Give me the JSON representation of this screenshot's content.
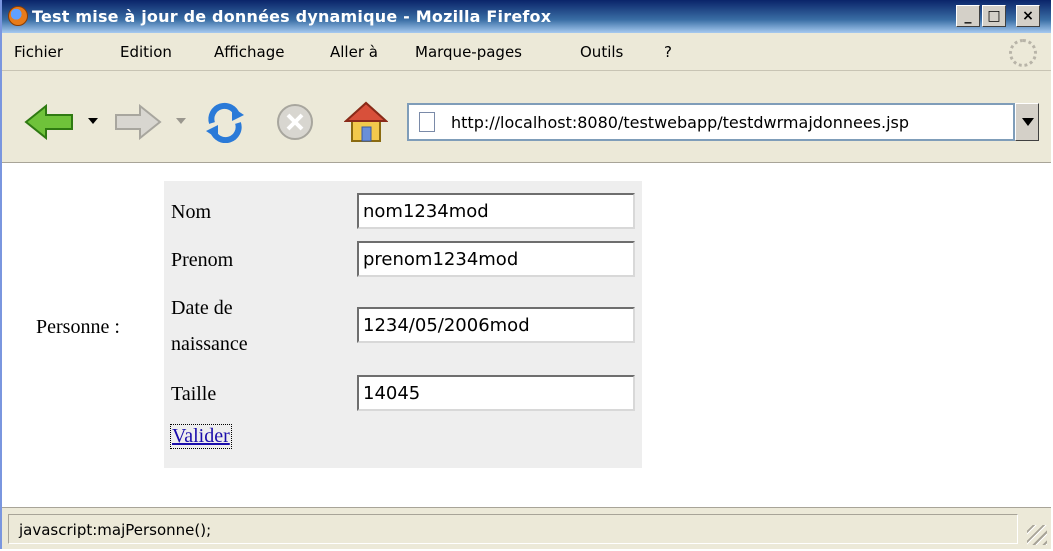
{
  "window": {
    "title": "Test mise à jour de données dynamique - Mozilla Firefox",
    "min_label": "_",
    "max_label": "□",
    "close_label": "×"
  },
  "menu": {
    "items": [
      {
        "label": "Fichier"
      },
      {
        "label": "Edition"
      },
      {
        "label": "Affichage"
      },
      {
        "label": "Aller à"
      },
      {
        "label": "Marque-pages"
      },
      {
        "label": "Outils"
      },
      {
        "label": "?"
      }
    ]
  },
  "navbar": {
    "url": "http://localhost:8080/testwebapp/testdwrmajdonnees.jsp"
  },
  "form": {
    "section_label": "Personne :",
    "fields": [
      {
        "label": "Nom",
        "value": "nom1234mod"
      },
      {
        "label": "Prenom",
        "value": "prenom1234mod"
      },
      {
        "label": "Date de naissance",
        "label_line1": "Date de",
        "label_line2": "naissance",
        "value": "1234/05/2006mod"
      },
      {
        "label": "Taille",
        "value": "14045"
      }
    ],
    "submit_label": "Valider"
  },
  "status": {
    "text": "javascript:majPersonne();"
  },
  "colors": {
    "titlebar": "#0a246a",
    "link": "#1a0dab",
    "form_bg": "#eeeeee"
  }
}
